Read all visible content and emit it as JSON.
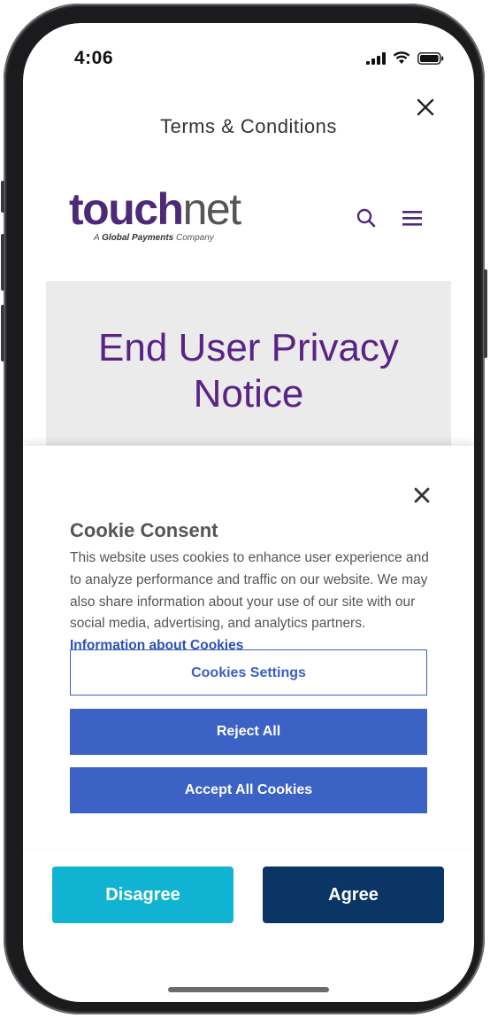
{
  "status_bar": {
    "time": "4:06"
  },
  "header": {
    "title": "Terms & Conditions"
  },
  "site": {
    "logo_main": "touch",
    "logo_accent": "net",
    "logo_tagline_prefix": "A ",
    "logo_tagline_brand": "Global Payments",
    "logo_tagline_suffix": " Company",
    "hero_line1": "End User Privacy",
    "hero_line2": "Notice"
  },
  "cookie_banner": {
    "title": "Cookie Consent",
    "body": "This website uses cookies to enhance user experience and to analyze performance and traffic on our website. We may also share information about your use of our site with our social media, advertising, and analytics partners.",
    "link_label": "Information about Cookies",
    "settings_label": "Cookies Settings",
    "reject_label": "Reject All",
    "accept_label": "Accept All Cookies"
  },
  "actions": {
    "disagree_label": "Disagree",
    "agree_label": "Agree"
  },
  "colors": {
    "brand_purple": "#5a2384",
    "cookie_blue": "#3d62c5",
    "disagree_cyan": "#11b3d3",
    "agree_navy": "#0a3564"
  },
  "icons": {
    "close": "close-icon",
    "search": "search-icon",
    "menu": "menu-icon",
    "signal": "signal-icon",
    "wifi": "wifi-icon",
    "battery": "battery-icon"
  }
}
